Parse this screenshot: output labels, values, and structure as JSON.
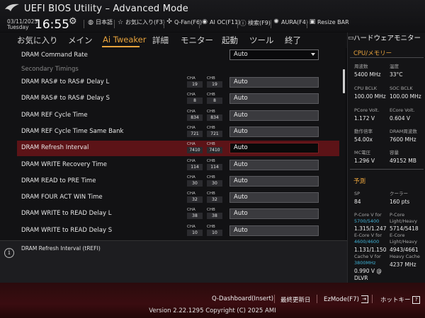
{
  "header": {
    "title": "UEFI BIOS Utility – Advanced Mode",
    "date": "03/11/2025",
    "weekday": "Tuesday",
    "time": "16:55",
    "items": [
      {
        "icon": "globe-icon",
        "label": "日本語"
      },
      {
        "icon": "star-icon",
        "label": "お気に入り(F3)"
      },
      {
        "icon": "fan-icon",
        "label": "Q-Fan(F6)"
      },
      {
        "icon": "ai-icon",
        "label": "AI OC(F11)"
      },
      {
        "icon": "help-icon",
        "label": "検索(F9)"
      },
      {
        "icon": "aura-icon",
        "label": "AURA(F4)"
      },
      {
        "icon": "resize-bar-icon",
        "label": "Resize BAR"
      }
    ]
  },
  "menu": {
    "tabs": [
      "お気に入り",
      "メイン",
      "Ai Tweaker",
      "詳細",
      "モニター",
      "起動",
      "ツール",
      "終了"
    ],
    "active": "Ai Tweaker"
  },
  "main": {
    "command_rate": {
      "label": "DRAM Command Rate",
      "value": "Auto"
    },
    "section_label": "Secondary Timings",
    "channel_a_label": "CHA",
    "channel_b_label": "CHB",
    "rows": [
      {
        "label": "DRAM RAS# to RAS# Delay L",
        "cha": "19",
        "chb": "19",
        "value": "Auto"
      },
      {
        "label": "DRAM RAS# to RAS# Delay S",
        "cha": "8",
        "chb": "8",
        "value": "Auto"
      },
      {
        "label": "DRAM REF Cycle Time",
        "cha": "834",
        "chb": "834",
        "value": "Auto"
      },
      {
        "label": "DRAM REF Cycle Time Same Bank",
        "cha": "721",
        "chb": "721",
        "value": "Auto"
      },
      {
        "label": "DRAM Refresh Interval",
        "cha": "7410",
        "chb": "7410",
        "value": "Auto"
      },
      {
        "label": "DRAM WRITE Recovery Time",
        "cha": "114",
        "chb": "114",
        "value": "Auto"
      },
      {
        "label": "DRAM READ to PRE Time",
        "cha": "30",
        "chb": "30",
        "value": "Auto"
      },
      {
        "label": "DRAM FOUR ACT WIN Time",
        "cha": "32",
        "chb": "32",
        "value": "Auto"
      },
      {
        "label": "DRAM WRITE to READ Delay L",
        "cha": "38",
        "chb": "38",
        "value": "Auto"
      },
      {
        "label": "DRAM WRITE to READ Delay S",
        "cha": "10",
        "chb": "10",
        "value": "Auto"
      }
    ],
    "selected_row": "DRAM Refresh Interval"
  },
  "info": {
    "text": "DRAM Refresh Interval (tREFI)"
  },
  "hwmon": {
    "title": "ハードウェアモニター",
    "sections": {
      "cpu_memory": "CPU/メモリー",
      "prediction": "予測"
    },
    "cpu": [
      {
        "label": "周波数",
        "value": "5400 MHz"
      },
      {
        "label": "温度",
        "value": "33°C"
      },
      {
        "label": "CPU BCLK",
        "value": "100.00 MHz"
      },
      {
        "label": "SOC BCLK",
        "value": "100.00 MHz"
      },
      {
        "label": "PCore Volt.",
        "value": "1.172 V"
      },
      {
        "label": "ECore Volt.",
        "value": "0.604 V"
      },
      {
        "label": "動作倍率",
        "value": "54.00x"
      },
      {
        "label": "DRAM周波数",
        "value": "7600 MHz"
      },
      {
        "label": "MC電圧",
        "value": "1.296 V"
      },
      {
        "label": "容量",
        "value": "49152 MB"
      }
    ],
    "prediction": {
      "sp_label": "SP",
      "sp_value": "84",
      "cooler_label": "クーラー",
      "cooler_value": "160 pts",
      "pcore_v_label": "P-Core V for",
      "pcore_v_freq": "5700/5400",
      "pcore_v_value": "1.315/1.247",
      "pcore_lh_label1": "P-Core",
      "pcore_lh_label2": "Light/Heavy",
      "pcore_lh_value": "5714/5418",
      "ecore_v_label": "E-Core V for",
      "ecore_v_freq": "4600/4600",
      "ecore_v_value": "1.131/1.150",
      "ecore_lh_label1": "E-Core",
      "ecore_lh_label2": "Light/Heavy",
      "ecore_lh_value": "4943/4661",
      "cache_v_label": "Cache V for",
      "cache_v_freq": "3800MHz",
      "cache_v_value1": "0.990 V @",
      "cache_v_value2": "DLVR",
      "heavy_cache_label": "Heavy Cache",
      "heavy_cache_value": "4237 MHz"
    }
  },
  "footer": {
    "qdash": "Q-Dashboard(Insert)",
    "last_changes": "最終更新日",
    "ezmode": "EzMode(F7)",
    "hotkeys": "ホットキー",
    "help_glyph": "?",
    "copyright": "Version 2.22.1295 Copyright (C) 2025 AMI"
  },
  "colors": {
    "accent": "#e8a33c",
    "selected_row": "#5c1317",
    "cyan": "#3fb4d8"
  }
}
